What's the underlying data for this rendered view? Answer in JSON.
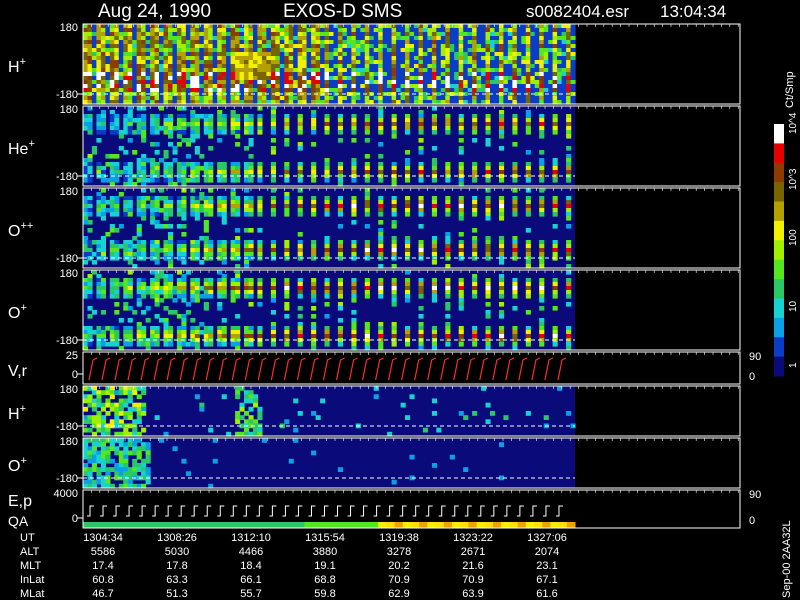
{
  "header": {
    "date": "Aug 24, 1990",
    "instrument": "EXOS-D SMS",
    "file": "s0082404.esr",
    "time": "13:04:34"
  },
  "colorbar": {
    "label": "Ct/Smp",
    "ticks": [
      "1",
      "10",
      "100",
      "10^3",
      "10^4"
    ],
    "colors": [
      "#0a0a7a",
      "#0a3cc8",
      "#0aa0e6",
      "#18d2d2",
      "#2ac864",
      "#54e61e",
      "#a0f000",
      "#f0f000",
      "#b4a000",
      "#786400",
      "#8c3c00",
      "#e60000",
      "#ffffff"
    ]
  },
  "panels": [
    {
      "id": "h-plus",
      "label": "H",
      "sup": "+",
      "ytop": "180",
      "ybot": "-180"
    },
    {
      "id": "he-plus",
      "label": "He",
      "sup": "+",
      "ytop": "180",
      "ybot": "-180"
    },
    {
      "id": "o-plusplus",
      "label": "O",
      "sup": "++",
      "ytop": "180",
      "ybot": "-180"
    },
    {
      "id": "o-plus",
      "label": "O",
      "sup": "+",
      "ytop": "180",
      "ybot": "-180"
    },
    {
      "id": "vr",
      "label": "V,r",
      "sup": "",
      "ytop": "25",
      "ybot": "0",
      "rtop": "90",
      "rbot": "0"
    },
    {
      "id": "h-plus-2",
      "label": "H",
      "sup": "+",
      "ytop": "180",
      "ybot": "-180"
    },
    {
      "id": "o-plus-2",
      "label": "O",
      "sup": "+",
      "ytop": "180",
      "ybot": "-180"
    },
    {
      "id": "ep-qa",
      "label": "E,p",
      "label2": "QA",
      "sup": "",
      "ytop": "4000",
      "ybot": "0",
      "rtop": "90",
      "rbot": "0"
    }
  ],
  "chart_data": {
    "type": "heatmap",
    "title": "Aug 24, 1990   EXOS-D SMS   s0082404.esr   13:04:34",
    "x_label_rows": [
      "UT",
      "ALT",
      "MLT",
      "InLat",
      "MLat"
    ],
    "x": [
      "1304:34",
      "1308:26",
      "1312:10",
      "1315:54",
      "1319:38",
      "1323:22",
      "1327:06"
    ],
    "ALT": [
      5586,
      5030,
      4466,
      3880,
      3278,
      2671,
      2074
    ],
    "MLT": [
      17.4,
      17.8,
      18.4,
      19.1,
      20.2,
      21.6,
      23.1
    ],
    "InLat": [
      60.8,
      63.3,
      66.1,
      68.8,
      70.9,
      70.9,
      67.1
    ],
    "MLat": [
      46.7,
      51.3,
      55.7,
      59.8,
      62.9,
      63.9,
      61.6
    ],
    "ylim": [
      -180,
      180
    ],
    "colorscale": "log, 1 to 10^4 Ct/Smp"
  },
  "footer": {
    "stamp": "Sep-00  2AA32L"
  }
}
